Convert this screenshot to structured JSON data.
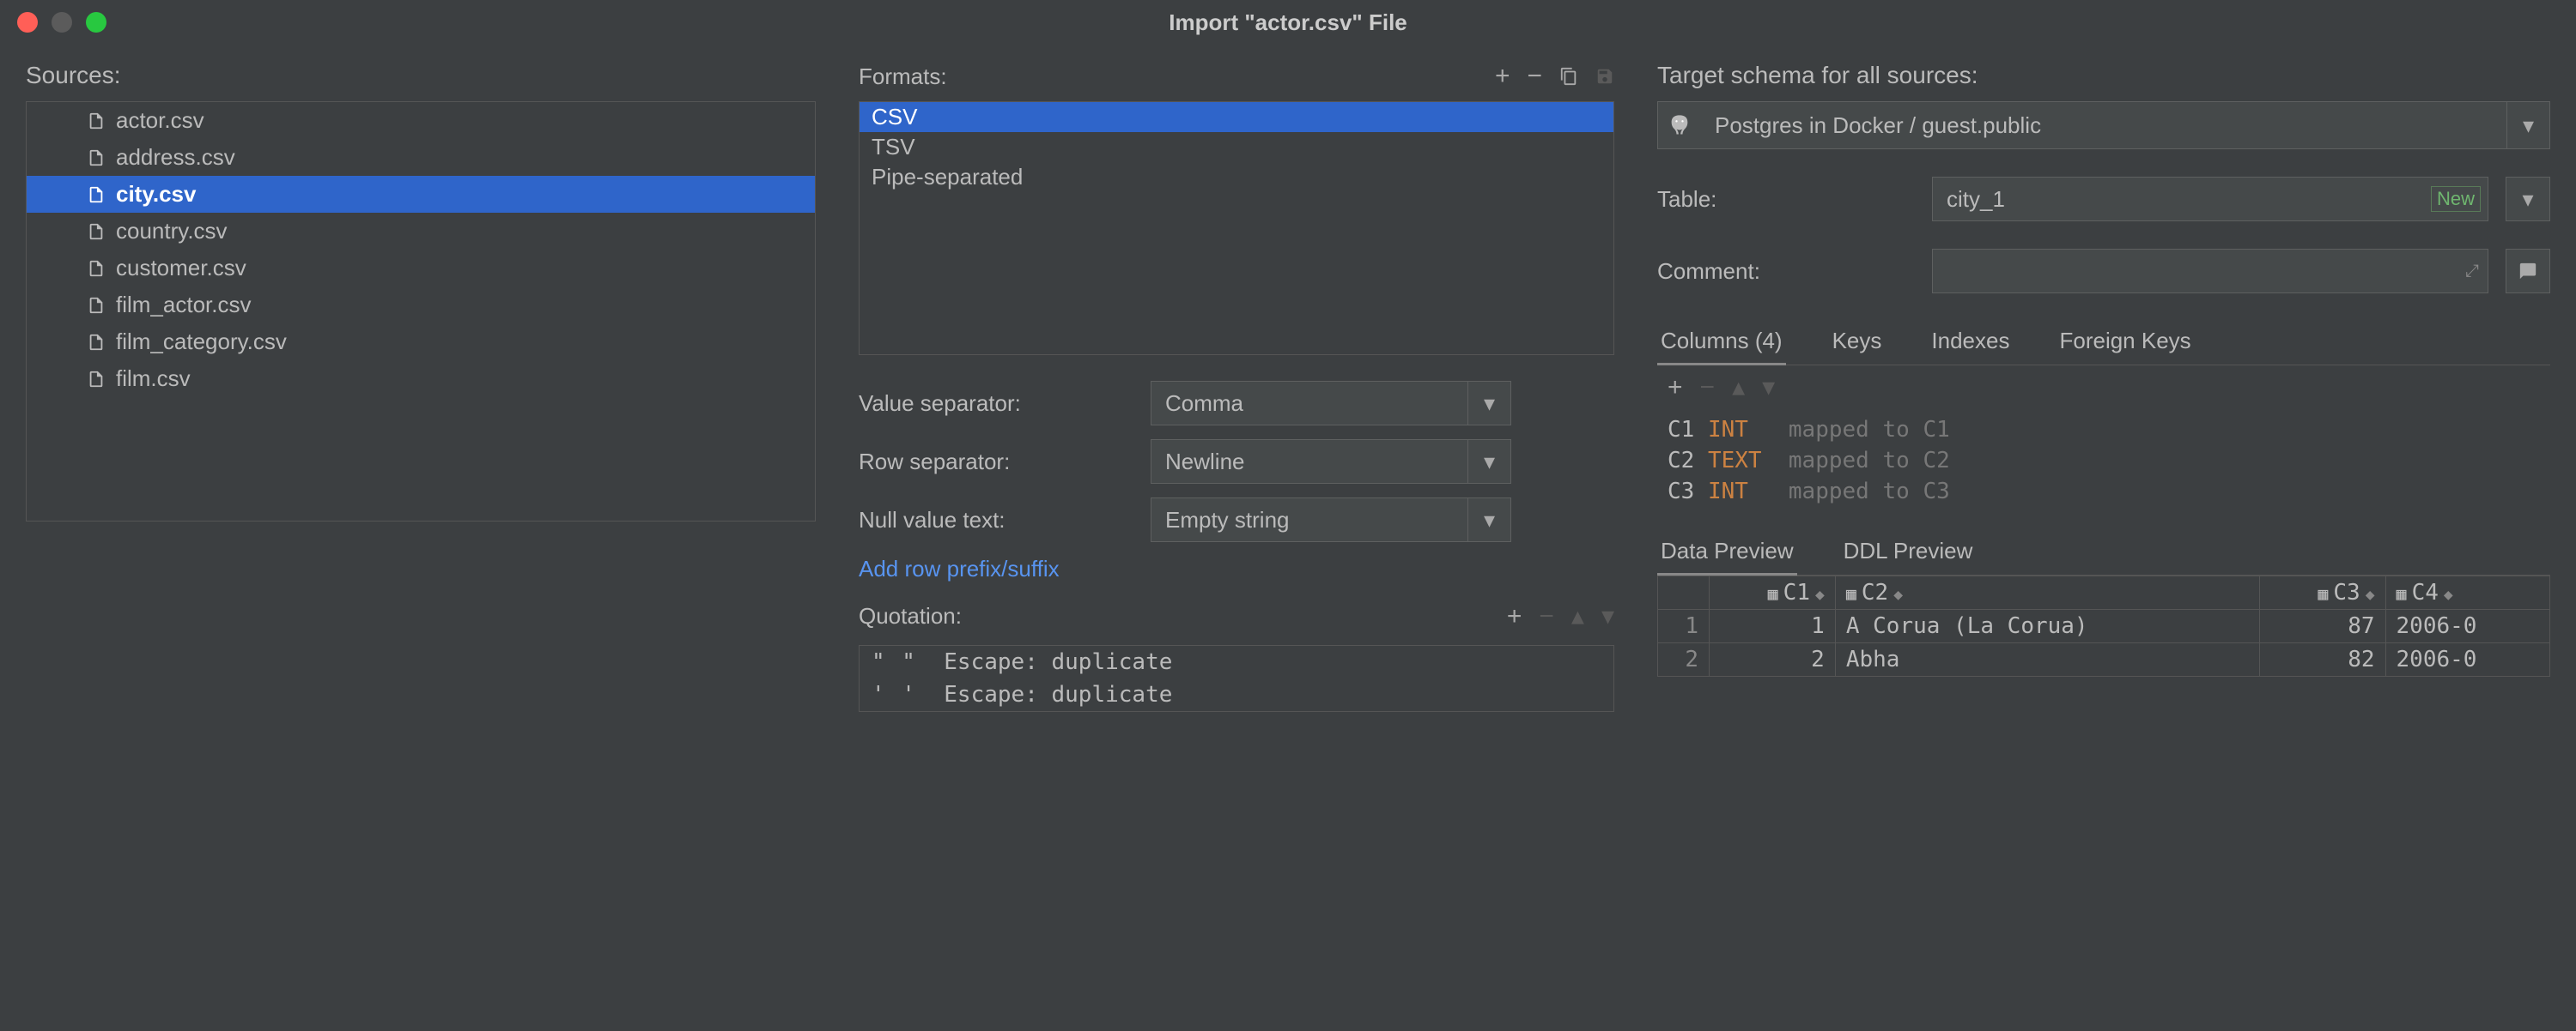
{
  "window": {
    "title": "Import \"actor.csv\" File"
  },
  "sources": {
    "label": "Sources:",
    "items": [
      {
        "name": "actor.csv",
        "selected": false
      },
      {
        "name": "address.csv",
        "selected": false
      },
      {
        "name": "city.csv",
        "selected": true
      },
      {
        "name": "country.csv",
        "selected": false
      },
      {
        "name": "customer.csv",
        "selected": false
      },
      {
        "name": "film_actor.csv",
        "selected": false
      },
      {
        "name": "film_category.csv",
        "selected": false
      },
      {
        "name": "film.csv",
        "selected": false
      }
    ]
  },
  "formats": {
    "label": "Formats:",
    "items": [
      {
        "name": "CSV",
        "selected": true
      },
      {
        "name": "TSV",
        "selected": false
      },
      {
        "name": "Pipe-separated",
        "selected": false
      }
    ],
    "value_separator_label": "Value separator:",
    "value_separator": "Comma",
    "row_separator_label": "Row separator:",
    "row_separator": "Newline",
    "null_text_label": "Null value text:",
    "null_text": "Empty string",
    "add_prefix_link": "Add row prefix/suffix",
    "quotation_label": "Quotation:",
    "quotation": [
      {
        "chars": "\" \"",
        "escape": "Escape: duplicate"
      },
      {
        "chars": "' '",
        "escape": "Escape: duplicate"
      }
    ]
  },
  "target": {
    "schema_label": "Target schema for all sources:",
    "schema": "Postgres in Docker / guest.public",
    "table_label": "Table:",
    "table_value": "city_1",
    "table_badge": "New",
    "comment_label": "Comment:",
    "comment_value": "",
    "tabs": [
      {
        "label": "Columns (4)",
        "active": true
      },
      {
        "label": "Keys",
        "active": false
      },
      {
        "label": "Indexes",
        "active": false
      },
      {
        "label": "Foreign Keys",
        "active": false
      }
    ],
    "columns": [
      {
        "name": "C1",
        "type": "INT",
        "mapped": "mapped to C1"
      },
      {
        "name": "C2",
        "type": "TEXT",
        "mapped": "mapped to C2"
      },
      {
        "name": "C3",
        "type": "INT",
        "mapped": "mapped to C3"
      }
    ],
    "preview_tabs": [
      {
        "label": "Data Preview",
        "active": true
      },
      {
        "label": "DDL Preview",
        "active": false
      }
    ],
    "preview_headers": [
      "C1",
      "C2",
      "C3",
      "C4"
    ],
    "preview_rows": [
      {
        "n": "1",
        "c1": "1",
        "c2": "A Corua (La Corua)",
        "c3": "87",
        "c4": "2006-0"
      },
      {
        "n": "2",
        "c1": "2",
        "c2": "Abha",
        "c3": "82",
        "c4": "2006-0"
      }
    ]
  }
}
